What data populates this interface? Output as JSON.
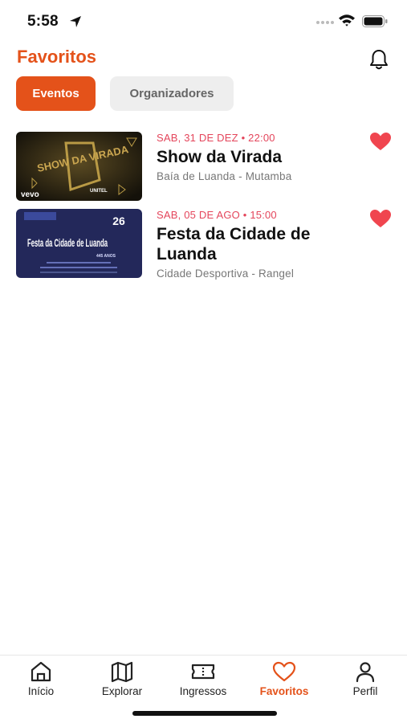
{
  "status_bar": {
    "time": "5:58"
  },
  "header": {
    "title": "Favoritos"
  },
  "segments": {
    "active_label": "Eventos",
    "inactive_label": "Organizadores"
  },
  "events": [
    {
      "date": "SAB, 31 DE DEZ • 22:00",
      "title": "Show da Virada",
      "location": "Baía de Luanda - Mutamba",
      "poster_text": {
        "main": "SHOW DA VIRADA",
        "brand_left": "vevo",
        "brand_right": "UNITEL"
      }
    },
    {
      "date": "SAB, 05 DE AGO • 15:00",
      "title": "Festa da Cidade de Luanda",
      "location": "Cidade Desportiva - Rangel",
      "poster_text": {
        "main": "Festa da Cidade de Luanda",
        "day": "26",
        "years": "445 ANOS"
      }
    }
  ],
  "tab_bar": {
    "items": [
      {
        "label": "Início",
        "icon": "home-icon"
      },
      {
        "label": "Explorar",
        "icon": "map-icon"
      },
      {
        "label": "Ingressos",
        "icon": "ticket-icon"
      },
      {
        "label": "Favoritos",
        "icon": "heart-icon"
      },
      {
        "label": "Perfil",
        "icon": "person-icon"
      }
    ],
    "active": "Favoritos"
  },
  "colors": {
    "accent": "#e4521a",
    "date": "#e4455b",
    "heart": "#f0454f"
  }
}
